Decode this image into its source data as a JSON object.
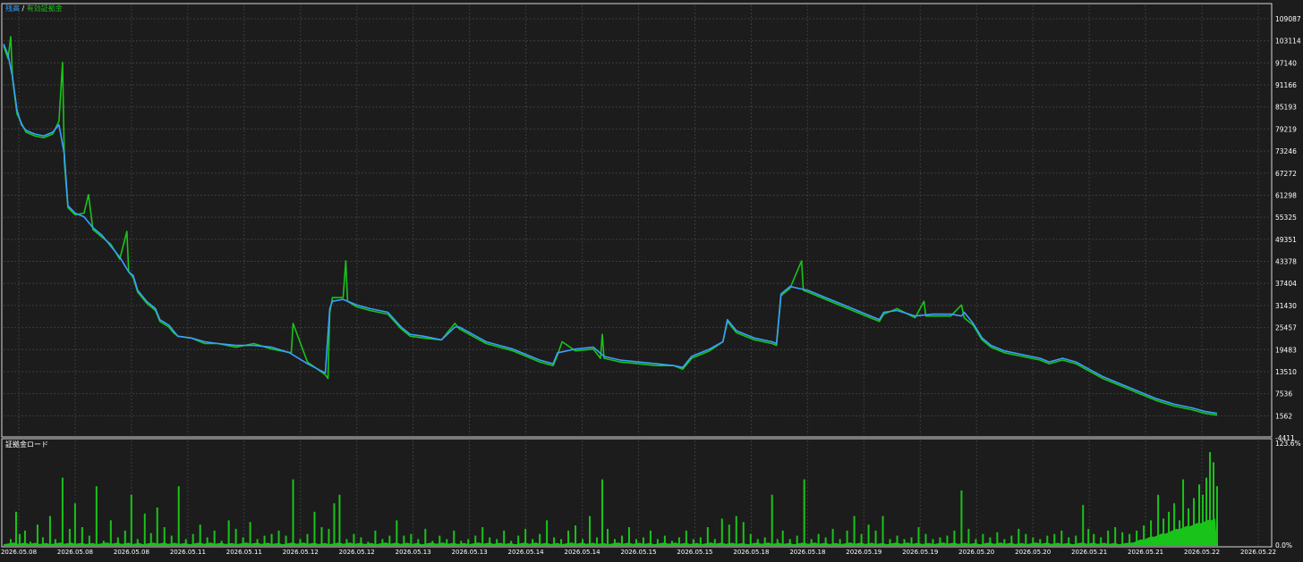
{
  "upper_legend": {
    "balance_label": "残高",
    "separator": " / ",
    "equity_label": "有効証拠金",
    "balance_color": "#3aa0ff",
    "equity_color": "#19c319"
  },
  "lower_legend": {
    "label": "証拠金ロード"
  },
  "colors": {
    "background": "#1c1c1c",
    "panel_border": "#d8d8d8",
    "grid": "#3c3c3c",
    "axis_text": "#ffffff",
    "bar": "#19c319",
    "balance": "#3aa0ff",
    "equity": "#19c319"
  },
  "chart_data": [
    {
      "type": "line",
      "title": "",
      "grid": true,
      "legend_placement": "top-left",
      "y_ticks": [
        "109087",
        "103114",
        "97140",
        "91166",
        "85193",
        "79219",
        "73246",
        "67272",
        "61298",
        "55325",
        "49351",
        "43378",
        "37404",
        "31430",
        "25457",
        "19483",
        "13510",
        "7536",
        "1562",
        "-4411"
      ],
      "ylim": [
        -4411,
        112500
      ],
      "xlim": [
        0,
        1358
      ],
      "x_ticks": [
        "2026.05.08",
        "2026.05.08",
        "2026.05.08",
        "2026.05.11",
        "2026.05.11",
        "2026.05.12",
        "2026.05.12",
        "2026.05.13",
        "2026.05.13",
        "2026.05.14",
        "2026.05.14",
        "2026.05.15",
        "2026.05.15",
        "2026.05.18",
        "2026.05.18",
        "2026.05.19",
        "2026.05.19",
        "2026.05.20",
        "2026.05.20",
        "2026.05.21",
        "2026.05.21",
        "2026.05.22",
        "2026.05.22"
      ],
      "series": [
        {
          "name": "残高",
          "color": "#3aa0ff",
          "x": [
            0,
            5,
            10,
            15,
            20,
            25,
            35,
            45,
            55,
            62,
            68,
            72,
            76,
            80,
            90,
            100,
            110,
            120,
            130,
            140,
            145,
            150,
            160,
            170,
            175,
            185,
            190,
            195,
            210,
            225,
            240,
            260,
            280,
            300,
            320,
            340,
            360,
            365,
            368,
            380,
            395,
            410,
            430,
            445,
            455,
            470,
            490,
            505,
            510,
            525,
            540,
            555,
            570,
            585,
            600,
            615,
            620,
            640,
            660,
            672,
            690,
            710,
            730,
            750,
            760,
            770,
            790,
            805,
            810,
            820,
            840,
            860,
            865,
            870,
            880,
            900,
            920,
            940,
            960,
            980,
            985,
            1000,
            1020,
            1040,
            1060,
            1072,
            1075,
            1085,
            1095,
            1105,
            1120,
            1140,
            1160,
            1170,
            1185,
            1200,
            1215,
            1230,
            1250,
            1270,
            1290,
            1310,
            1330,
            1345,
            1358
          ],
          "y": [
            102000,
            99000,
            93000,
            84000,
            80000,
            78500,
            77500,
            77000,
            78000,
            80000,
            72000,
            58000,
            57000,
            56000,
            55000,
            52000,
            50000,
            47000,
            44000,
            40000,
            39000,
            35000,
            32000,
            30000,
            27000,
            25500,
            24000,
            22500,
            22000,
            21000,
            20500,
            20000,
            20000,
            19500,
            18000,
            15000,
            12500,
            30000,
            32000,
            32500,
            31000,
            30000,
            29000,
            25000,
            23000,
            22500,
            21500,
            25000,
            25000,
            23000,
            21000,
            20000,
            19000,
            17500,
            16000,
            15000,
            18000,
            19000,
            19500,
            17000,
            16000,
            15500,
            15000,
            14500,
            14000,
            17000,
            19000,
            21000,
            27000,
            24000,
            22000,
            21000,
            20500,
            34000,
            36000,
            35000,
            33000,
            31000,
            29000,
            27000,
            29000,
            29500,
            28000,
            28500,
            28500,
            28000,
            29000,
            26000,
            22000,
            20000,
            18500,
            17500,
            16500,
            15500,
            16500,
            15500,
            13500,
            11500,
            9500,
            7500,
            5500,
            4000,
            3000,
            2000,
            1500
          ]
        },
        {
          "name": "有効証拠金",
          "color": "#19c319",
          "x": [
            0,
            5,
            8,
            10,
            15,
            20,
            25,
            35,
            45,
            55,
            62,
            66,
            68,
            72,
            76,
            80,
            90,
            95,
            100,
            110,
            120,
            130,
            138,
            140,
            145,
            150,
            160,
            170,
            175,
            185,
            190,
            195,
            210,
            225,
            240,
            260,
            280,
            300,
            322,
            324,
            340,
            360,
            363,
            365,
            368,
            380,
            383,
            385,
            395,
            410,
            430,
            445,
            455,
            470,
            490,
            505,
            510,
            525,
            540,
            555,
            570,
            585,
            600,
            615,
            620,
            625,
            640,
            660,
            668,
            670,
            672,
            690,
            710,
            730,
            750,
            760,
            770,
            790,
            805,
            810,
            820,
            840,
            860,
            865,
            870,
            880,
            893,
            895,
            900,
            920,
            940,
            960,
            980,
            985,
            1000,
            1020,
            1030,
            1032,
            1040,
            1060,
            1072,
            1075,
            1085,
            1095,
            1105,
            1120,
            1140,
            1160,
            1170,
            1185,
            1200,
            1215,
            1230,
            1250,
            1270,
            1290,
            1310,
            1330,
            1345,
            1358
          ],
          "y": [
            101500,
            98000,
            104000,
            92500,
            83000,
            80500,
            78000,
            77000,
            76500,
            77500,
            81000,
            97000,
            70000,
            57500,
            56500,
            55500,
            56000,
            61000,
            51500,
            49500,
            47500,
            43500,
            51000,
            40000,
            38500,
            34500,
            31500,
            29500,
            26500,
            25000,
            23500,
            22500,
            22000,
            20500,
            20500,
            19500,
            20500,
            19000,
            18000,
            26000,
            15500,
            12000,
            11000,
            29000,
            33000,
            33000,
            43000,
            32000,
            30500,
            29500,
            28500,
            24500,
            22500,
            22000,
            21500,
            26000,
            24500,
            22500,
            20500,
            19500,
            18500,
            17000,
            15500,
            14500,
            17500,
            21000,
            18500,
            19000,
            16500,
            23000,
            16500,
            15500,
            15000,
            14500,
            14500,
            13500,
            16500,
            18500,
            21000,
            26500,
            23500,
            21500,
            20500,
            20000,
            33500,
            35500,
            43000,
            35000,
            34500,
            32500,
            30500,
            28500,
            26500,
            28500,
            30000,
            27500,
            32000,
            28000,
            28000,
            28000,
            31000,
            27500,
            25500,
            21500,
            19500,
            18000,
            17000,
            16000,
            15000,
            16000,
            15000,
            13000,
            11000,
            9000,
            7000,
            5000,
            3500,
            2500,
            1500,
            1000
          ]
        }
      ]
    },
    {
      "type": "bar",
      "title": "",
      "grid": true,
      "legend_placement": "top-left",
      "ylabel": "",
      "y_ticks": [
        "123.6%",
        "0.0%"
      ],
      "ylim": [
        0,
        123.6
      ],
      "xlim": [
        0,
        1358
      ],
      "series": [
        {
          "name": "証拠金ロード",
          "color": "#19c319",
          "x": [
            8,
            14,
            18,
            24,
            30,
            38,
            44,
            52,
            58,
            66,
            74,
            80,
            88,
            96,
            104,
            112,
            120,
            128,
            136,
            143,
            150,
            158,
            165,
            172,
            180,
            188,
            196,
            204,
            212,
            220,
            228,
            236,
            244,
            252,
            260,
            268,
            276,
            284,
            292,
            300,
            308,
            316,
            324,
            332,
            340,
            348,
            356,
            364,
            370,
            376,
            384,
            392,
            400,
            408,
            416,
            424,
            432,
            440,
            448,
            456,
            464,
            472,
            480,
            488,
            496,
            504,
            512,
            520,
            528,
            536,
            544,
            552,
            560,
            568,
            576,
            584,
            592,
            600,
            608,
            616,
            624,
            632,
            640,
            648,
            656,
            664,
            670,
            676,
            684,
            692,
            700,
            708,
            716,
            724,
            732,
            740,
            748,
            756,
            764,
            772,
            780,
            788,
            796,
            804,
            812,
            820,
            828,
            836,
            844,
            852,
            860,
            866,
            872,
            880,
            888,
            896,
            904,
            912,
            920,
            928,
            936,
            944,
            952,
            960,
            968,
            976,
            984,
            992,
            1000,
            1008,
            1016,
            1024,
            1032,
            1040,
            1048,
            1056,
            1064,
            1072,
            1080,
            1088,
            1096,
            1104,
            1112,
            1120,
            1128,
            1136,
            1144,
            1152,
            1160,
            1168,
            1176,
            1184,
            1192,
            1200,
            1208,
            1214,
            1220,
            1228,
            1236,
            1244,
            1252,
            1260,
            1268,
            1276,
            1284,
            1292,
            1298,
            1304,
            1310,
            1316,
            1320,
            1326,
            1332,
            1338,
            1342,
            1346,
            1350,
            1354,
            1358
          ],
          "values": [
            8,
            40,
            14,
            18,
            5,
            25,
            10,
            35,
            8,
            80,
            20,
            50,
            22,
            12,
            70,
            6,
            30,
            10,
            18,
            60,
            8,
            38,
            15,
            45,
            22,
            12,
            70,
            8,
            14,
            25,
            10,
            18,
            6,
            30,
            20,
            10,
            28,
            8,
            12,
            14,
            18,
            12,
            78,
            8,
            14,
            40,
            22,
            20,
            50,
            60,
            8,
            14,
            10,
            5,
            18,
            8,
            12,
            30,
            12,
            14,
            8,
            20,
            6,
            12,
            8,
            18,
            6,
            8,
            12,
            22,
            10,
            8,
            18,
            6,
            12,
            20,
            8,
            14,
            30,
            10,
            8,
            18,
            24,
            8,
            35,
            10,
            78,
            20,
            8,
            12,
            22,
            8,
            10,
            18,
            8,
            12,
            6,
            10,
            18,
            8,
            10,
            22,
            8,
            32,
            25,
            35,
            28,
            14,
            8,
            10,
            60,
            8,
            18,
            8,
            12,
            78,
            8,
            14,
            10,
            20,
            8,
            18,
            35,
            14,
            25,
            18,
            35,
            8,
            12,
            8,
            10,
            22,
            14,
            8,
            10,
            12,
            18,
            65,
            20,
            8,
            14,
            10,
            16,
            8,
            12,
            20,
            14,
            10,
            8,
            12,
            14,
            18,
            10,
            12,
            48,
            20,
            14,
            10,
            18,
            22,
            16,
            14,
            18,
            24,
            30,
            60,
            32,
            40,
            50,
            30,
            78,
            44,
            56,
            72,
            60,
            80,
            110,
            98,
            70
          ]
        }
      ]
    }
  ]
}
